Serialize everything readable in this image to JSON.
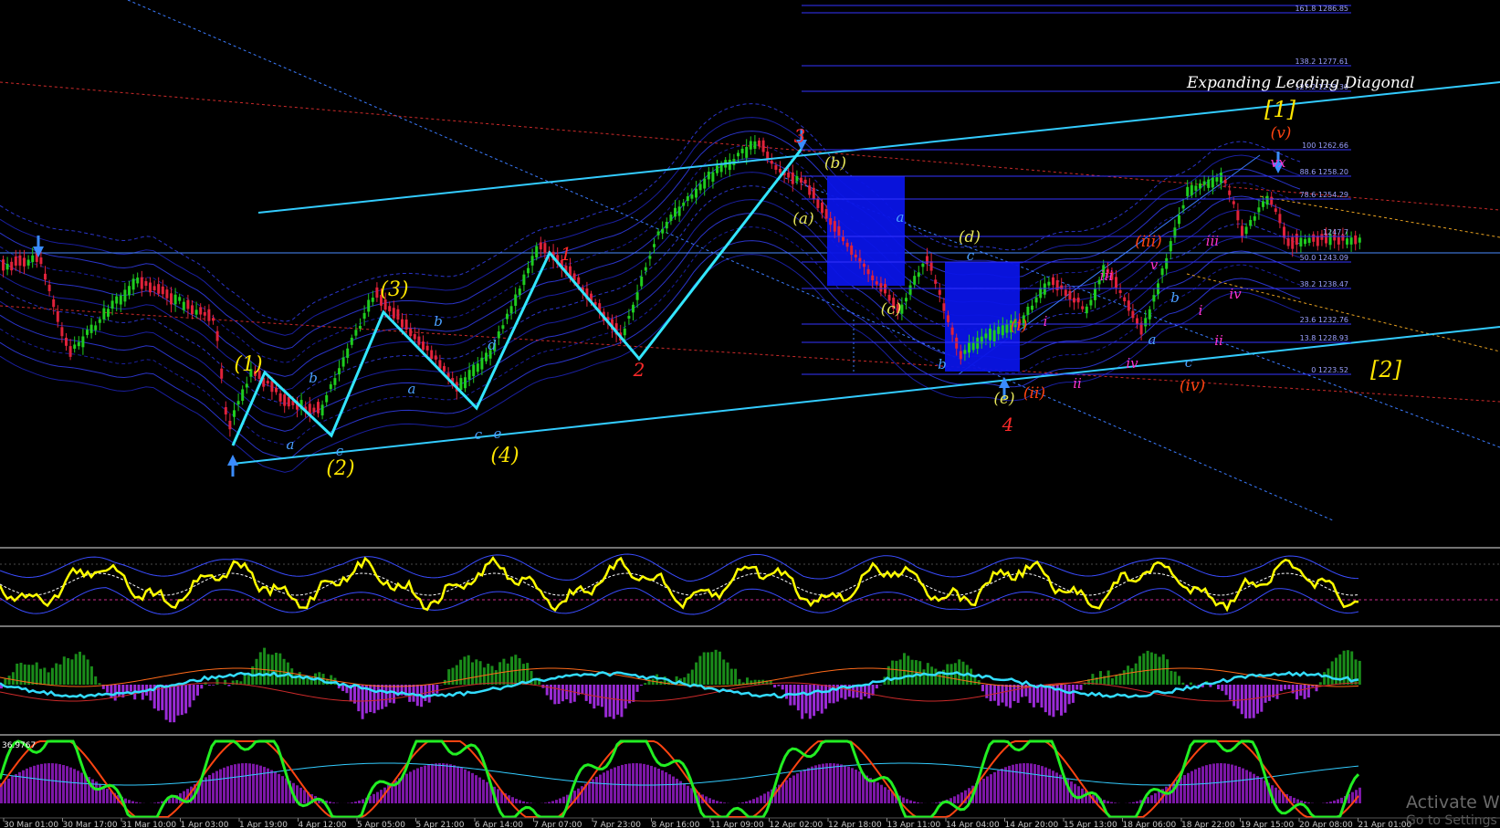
{
  "title": "Expanding Leading Diagonal",
  "oscillator_value": "36.9767",
  "watermark": {
    "line1": "Activate Wir",
    "line2": "Go to Settings"
  },
  "colors": {
    "background": "#000000",
    "bull_candle": "#1fcc1f",
    "bear_candle": "#e0223a",
    "channel": "#33ccff",
    "wave_path": "#33e6ff",
    "fib": "#3333ff",
    "highlight_box": "#0a14e6",
    "rsi": "#ffff00",
    "macd_line": "#33ddff",
    "hist_pos": "#1a8c1a",
    "hist_neg": "#9a2bd6",
    "stoch_k": "#22ee22",
    "stoch_d": "#ff4411"
  },
  "chart_data": {
    "type": "candlestick",
    "x_ticks": [
      "30 Mar 01:00",
      "30 Mar 17:00",
      "31 Mar 10:00",
      "1 Apr 03:00",
      "1 Apr 19:00",
      "4 Apr 12:00",
      "5 Apr 05:00",
      "5 Apr 21:00",
      "6 Apr 14:00",
      "7 Apr 07:00",
      "7 Apr 23:00",
      "8 Apr 16:00",
      "11 Apr 09:00",
      "12 Apr 02:00",
      "12 Apr 18:00",
      "13 Apr 11:00",
      "14 Apr 04:00",
      "14 Apr 20:00",
      "15 Apr 13:00",
      "18 Apr 06:00",
      "18 Apr 22:00",
      "19 Apr 15:00",
      "20 Apr 08:00",
      "21 Apr 01:00"
    ],
    "fib_levels": [
      {
        "label": "161.8 1286.85"
      },
      {
        "label": "138.2 1277.61"
      },
      {
        "label": "127.2 1273.30"
      },
      {
        "label": "100 1262.66"
      },
      {
        "label": "88.6 1258.20"
      },
      {
        "label": "78.6 1254.29"
      },
      {
        "label": "1247.7"
      },
      {
        "label": "50.0 1243.09"
      },
      {
        "label": "38.2 1238.47"
      },
      {
        "label": "23.6 1232.76"
      },
      {
        "label": "13.8 1228.93"
      },
      {
        "label": "0 1223.52"
      }
    ],
    "wave_labels": [
      {
        "text": "(1)",
        "color": "#ffe600"
      },
      {
        "text": "(2)",
        "color": "#ffe600"
      },
      {
        "text": "(3)",
        "color": "#ffe600"
      },
      {
        "text": "(4)",
        "color": "#ffe600"
      },
      {
        "text": "1",
        "color": "#ff2a2a"
      },
      {
        "text": "2",
        "color": "#ff2a2a"
      },
      {
        "text": "3",
        "color": "#ff2a2a"
      },
      {
        "text": "4",
        "color": "#ff2a2a"
      },
      {
        "text": "a",
        "color": "#4aa0ff"
      },
      {
        "text": "b",
        "color": "#4aa0ff"
      },
      {
        "text": "c",
        "color": "#4aa0ff"
      },
      {
        "text": "a",
        "color": "#4aa0ff"
      },
      {
        "text": "b",
        "color": "#4aa0ff"
      },
      {
        "text": "c",
        "color": "#4aa0ff"
      },
      {
        "text": "d",
        "color": "#4aa0ff"
      },
      {
        "text": "e",
        "color": "#4aa0ff"
      },
      {
        "text": "(a)",
        "color": "#e6e65a"
      },
      {
        "text": "(b)",
        "color": "#e6e65a"
      },
      {
        "text": "(c)",
        "color": "#e6e65a"
      },
      {
        "text": "(d)",
        "color": "#e6e65a"
      },
      {
        "text": "(e)",
        "color": "#e6e65a"
      },
      {
        "text": "a",
        "color": "#4aa0ff"
      },
      {
        "text": "b",
        "color": "#4aa0ff"
      },
      {
        "text": "c",
        "color": "#4aa0ff"
      },
      {
        "text": "b",
        "color": "#4aa0ff"
      },
      {
        "text": "a",
        "color": "#4aa0ff"
      },
      {
        "text": "c",
        "color": "#4aa0ff"
      },
      {
        "text": "(i)",
        "color": "#ff4411"
      },
      {
        "text": "(ii)",
        "color": "#ff4411"
      },
      {
        "text": "(iii)",
        "color": "#ff4411"
      },
      {
        "text": "(iv)",
        "color": "#ff4411"
      },
      {
        "text": "(v)",
        "color": "#ff4411"
      },
      {
        "text": "i",
        "color": "#ff33cc"
      },
      {
        "text": "ii",
        "color": "#ff33cc"
      },
      {
        "text": "iii",
        "color": "#ff33cc"
      },
      {
        "text": "iv",
        "color": "#ff33cc"
      },
      {
        "text": "v",
        "color": "#ff33cc"
      },
      {
        "text": "i",
        "color": "#ff33cc"
      },
      {
        "text": "ii",
        "color": "#ff33cc"
      },
      {
        "text": "iii",
        "color": "#ff33cc"
      },
      {
        "text": "iv",
        "color": "#ff33cc"
      },
      {
        "text": "vx",
        "color": "#ff33cc"
      },
      {
        "text": "[1]",
        "color": "#ffe600"
      },
      {
        "text": "[2]",
        "color": "#ffe600"
      }
    ]
  }
}
